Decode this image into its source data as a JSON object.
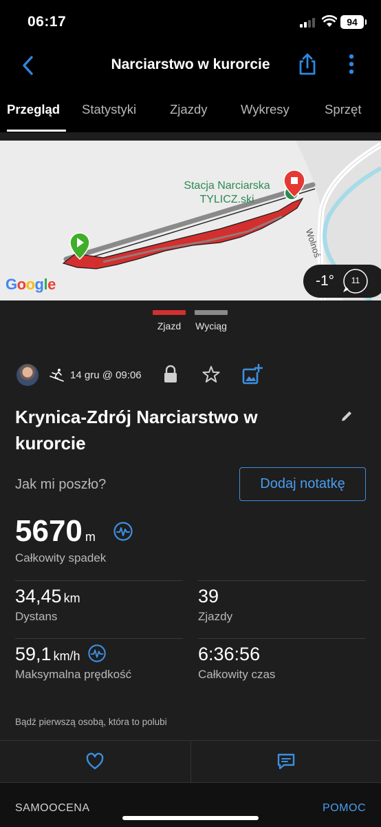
{
  "status_bar": {
    "time": "06:17",
    "battery": "94"
  },
  "header": {
    "title": "Narciarstwo w kurorcie"
  },
  "tabs": [
    {
      "label": "Przegląd",
      "active": true
    },
    {
      "label": "Statystyki",
      "active": false
    },
    {
      "label": "Zjazdy",
      "active": false
    },
    {
      "label": "Wykresy",
      "active": false
    },
    {
      "label": "Sprzęt",
      "active": false
    }
  ],
  "map": {
    "place_label_line1": "Stacja Narciarska",
    "place_label_line2": "TYLICZ.ski",
    "road_label": "Wolnoś",
    "google_logo": "Google",
    "temperature": "-1°",
    "wind_speed": "11"
  },
  "legend": {
    "run_label": "Zjazd",
    "lift_label": "Wyciąg",
    "run_color": "#d32f2f",
    "lift_color": "#8a8a8a"
  },
  "activity": {
    "date": "14 gru @ 09:06",
    "title": "Krynica-Zdrój Narciarstwo w kurorcie",
    "how_prompt": "Jak mi poszło?",
    "add_note_label": "Dodaj notatkę",
    "total_descent": {
      "value": "5670",
      "unit": "m",
      "label": "Całkowity spadek"
    },
    "distance": {
      "value": "34,45",
      "unit": "km",
      "label": "Dystans"
    },
    "runs": {
      "value": "39",
      "label": "Zjazdy"
    },
    "max_speed": {
      "value": "59,1",
      "unit": "km/h",
      "label": "Maksymalna prędkość"
    },
    "total_time": {
      "value": "6:36:56",
      "label": "Całkowity czas"
    },
    "likes_text": "Bądź pierwszą osobą, która to polubi"
  },
  "footer": {
    "self_eval_label": "SAMOOCENA",
    "help_label": "POMOC"
  },
  "colors": {
    "accent": "#3d8fe0",
    "background": "#1e1e1e",
    "map_bg": "#ececec"
  }
}
